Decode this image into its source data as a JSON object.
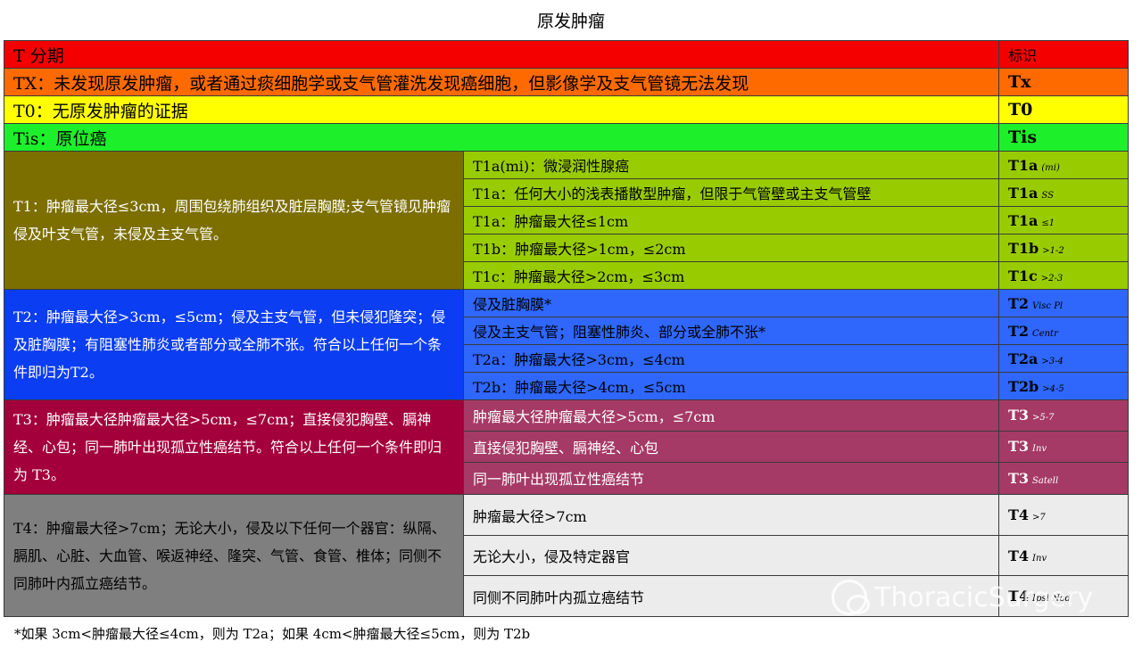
{
  "title": "原发肿瘤",
  "header": {
    "stage": "T 分期",
    "label": "标识"
  },
  "rows_top": [
    {
      "text": "TX：未发现原发肿瘤，或者通过痰细胞学或支气管灌洗发现癌细胞，但影像学及支气管镜无法发现",
      "code": "Tx"
    },
    {
      "text": "T0：无原发肿瘤的证据",
      "code": "T0"
    },
    {
      "text": "Tis：原位癌",
      "code": "Tis"
    }
  ],
  "groups": [
    {
      "text": "T1：肿瘤最大径≤3cm，周围包绕肺组织及脏层胸膜;支气管镜见肿瘤侵及叶支气管，未侵及主支气管。",
      "subs": [
        {
          "text": "T1a(mi)：微浸润性腺癌",
          "code": "T1a",
          "suffix": "(mi)"
        },
        {
          "text": "T1a：任何大小的浅表播散型肿瘤，但限于气管壁或主支气管壁",
          "code": "T1a",
          "suffix": "SS"
        },
        {
          "text": "T1a：肿瘤最大径≤1cm",
          "code": "T1a",
          "suffix": "≤1"
        },
        {
          "text": "T1b：肿瘤最大径>1cm，≤2cm",
          "code": "T1b",
          "suffix": ">1-2"
        },
        {
          "text": "T1c：肿瘤最大径>2cm，≤3cm",
          "code": "T1c",
          "suffix": ">2-3"
        }
      ]
    },
    {
      "text": "T2：肿瘤最大径>3cm，≤5cm；侵及主支气管，但未侵犯隆突；侵及脏胸膜；有阻塞性肺炎或者部分或全肺不张。符合以上任何一个条件即归为T2。",
      "subs": [
        {
          "text": "侵及脏胸膜*",
          "code": "T2",
          "suffix": "Visc Pl"
        },
        {
          "text": "侵及主支气管；阻塞性肺炎、部分或全肺不张*",
          "code": "T2",
          "suffix": "Centr"
        },
        {
          "text": "T2a：肿瘤最大径>3cm，≤4cm",
          "code": "T2a",
          "suffix": ">3-4"
        },
        {
          "text": "T2b：肿瘤最大径>4cm，≤5cm",
          "code": "T2b",
          "suffix": ">4-5"
        }
      ]
    },
    {
      "text": "T3：肿瘤最大径肿瘤最大径>5cm，≤7cm；直接侵犯胸壁、膈神经、心包；同一肺叶出现孤立性癌结节。符合以上任何一个条件即归为 T3。",
      "subs": [
        {
          "text": "肿瘤最大径肿瘤最大径>5cm，≤7cm",
          "code": "T3",
          "suffix": ">5-7"
        },
        {
          "text": "直接侵犯胸壁、膈神经、心包",
          "code": "T3",
          "suffix": "Inv"
        },
        {
          "text": "同一肺叶出现孤立性癌结节",
          "code": "T3",
          "suffix": "Satell"
        }
      ]
    },
    {
      "text": "T4：肿瘤最大径>7cm；无论大小，侵及以下任何一个器官：纵隔、膈肌、心脏、大血管、喉返神经、隆突、气管、食管、椎体；同侧不同肺叶内孤立癌结节。",
      "subs": [
        {
          "text": "肿瘤最大径>7cm",
          "code": "T4",
          "suffix": ">7"
        },
        {
          "text": "无论大小，侵及特定器官",
          "code": "T4",
          "suffix": "Inv"
        },
        {
          "text": "同侧不同肺叶内孤立癌结节",
          "code": "T4",
          "suffix": "Ipsi Nod"
        }
      ]
    }
  ],
  "footnote": "*如果 3cm<肿瘤最大径≤4cm，则为 T2a；如果 4cm<肿瘤最大径≤5cm，则为 T2b",
  "watermark": "ThoracicSurgery",
  "colors": {
    "red": "#f40000",
    "orange": "#ff6a00",
    "yellow": "#ffff00",
    "green": "#1df02a",
    "t1": "#7c6f00",
    "t1_sub": "#99cc00",
    "t2": "#0b3df2",
    "t2_sub": "#2f67fc",
    "t3": "#a3003b",
    "t3_sub": "#a53a66",
    "t4": "#7f7f7f",
    "t4_sub": "#ececec"
  }
}
